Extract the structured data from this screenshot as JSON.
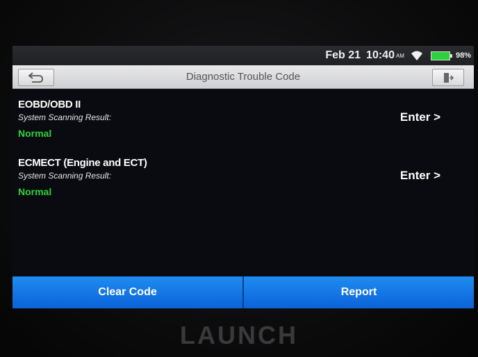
{
  "status": {
    "date": "Feb 21",
    "time": "10:40",
    "ampm": "AM",
    "battery": "98%",
    "battery_level": 0.98
  },
  "titlebar": {
    "title": "Diagnostic Trouble Code",
    "back_icon": "back-arrow-icon",
    "exit_icon": "exit-icon"
  },
  "systems": [
    {
      "name": "EOBD/OBD II",
      "label": "System Scanning Result:",
      "status": "Normal",
      "action": "Enter >"
    },
    {
      "name": "ECMECT (Engine and ECT)",
      "label": "System Scanning Result:",
      "status": "Normal",
      "action": "Enter >"
    }
  ],
  "buttons": {
    "clear": "Clear Code",
    "report": "Report"
  },
  "brand": "LAUNCH",
  "colors": {
    "accent_blue": "#0b74e8",
    "status_green": "#2fd23c",
    "title_text": "#555555"
  }
}
